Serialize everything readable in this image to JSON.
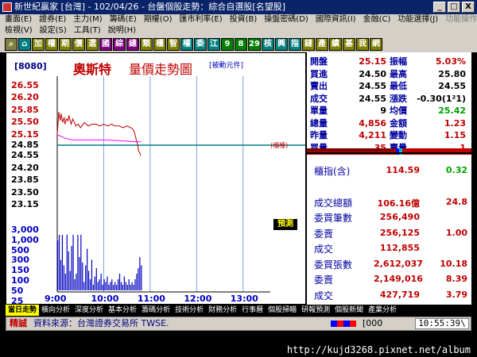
{
  "window": {
    "title": "新世紀贏家 [台灣] - 102/04/26 - 台盤個股走勢：綜合自選股[名望股]",
    "min": "_",
    "max": "□",
    "close": "X"
  },
  "menu": {
    "row1": [
      "畫面(E)",
      "證券(E)",
      "主力(M)",
      "籌碼(E)",
      "期權(O)",
      "匯市利率(E)",
      "投資(B)",
      "操盤密碼(D)",
      "國際資訊(I)",
      "金融(C)",
      "功能選擇(J)"
    ],
    "row1_right": "功能操作(",
    "row2": [
      "檢視(V)",
      "設定(S)",
      "工具(T)",
      "說明(H)"
    ]
  },
  "toolbar": [
    {
      "label": "⌕",
      "name": "search-icon",
      "bg": "#808040"
    },
    {
      "label": "⌂",
      "name": "home-icon",
      "bg": "#008080"
    },
    {
      "label": "加",
      "name": "tb-add",
      "bg": "#808000"
    },
    {
      "label": "權",
      "name": "tb-weight",
      "bg": "#808000"
    },
    {
      "label": "期",
      "name": "tb-futures",
      "bg": "#808000"
    },
    {
      "label": "價",
      "name": "tb-price",
      "bg": "#808000"
    },
    {
      "label": "選",
      "name": "tb-select",
      "bg": "#808000"
    },
    {
      "label": "國",
      "name": "tb-intl",
      "bg": "#800080"
    },
    {
      "label": "綜",
      "name": "tb-composite",
      "bg": "#800080"
    },
    {
      "label": "總",
      "name": "tb-total",
      "bg": "#800080"
    },
    {
      "label": "類",
      "name": "tb-category",
      "bg": "#808000"
    },
    {
      "label": "櫃",
      "name": "tb-otc",
      "bg": "#808000"
    },
    {
      "label": "智",
      "name": "tb-smart",
      "bg": "#808000"
    },
    {
      "label": "權",
      "name": "tb-rights",
      "bg": "#008080"
    },
    {
      "label": "委",
      "name": "tb-order",
      "bg": "#008080"
    },
    {
      "label": "江",
      "name": "tb-jiang",
      "bg": "#008080"
    },
    {
      "label": "9",
      "name": "tb-9",
      "bg": "#008000"
    },
    {
      "label": "8",
      "name": "tb-8",
      "bg": "#008000"
    },
    {
      "label": "29",
      "name": "tb-29",
      "bg": "#008000"
    },
    {
      "label": "核",
      "name": "tb-core",
      "bg": "#008080"
    },
    {
      "label": "興",
      "name": "tb-emerging",
      "bg": "#008080"
    },
    {
      "label": "指",
      "name": "tb-index",
      "bg": "#008080"
    },
    {
      "label": "鏈",
      "name": "tb-chain",
      "bg": "#808000"
    },
    {
      "label": "產",
      "name": "tb-industry",
      "bg": "#808000"
    },
    {
      "label": "績",
      "name": "tb-perf",
      "bg": "#808000"
    },
    {
      "label": "基",
      "name": "tb-fund",
      "bg": "#808000"
    },
    {
      "label": "我",
      "name": "tb-mine",
      "bg": "#808000"
    },
    {
      "label": "網",
      "name": "tb-web",
      "bg": "#808000"
    }
  ],
  "stock": {
    "code": "[8080]",
    "name": "奧斯特",
    "chart_title": "量價走勢圖",
    "passive": "[被動元件]"
  },
  "chart_labels": {
    "ref": "(櫃檯)",
    "forecast": "預測"
  },
  "quote": [
    {
      "l1": "開盤",
      "v1": "25.15",
      "c1": "#c00000",
      "l2": "振幅",
      "v2": "5.03%",
      "c2": "#c00000"
    },
    {
      "l1": "買進",
      "v1": "24.50",
      "c1": "#000000",
      "l2": "最高",
      "v2": "25.80",
      "c2": "#000000"
    },
    {
      "l1": "賣出",
      "v1": "24.55",
      "c1": "#000000",
      "l2": "最低",
      "v2": "24.55",
      "c2": "#000000"
    },
    {
      "l1": "成交",
      "v1": "24.55",
      "c1": "#000000",
      "l2": "漲跌",
      "v2": "-0.30(1²1)",
      "c2": "#000000"
    },
    {
      "l1": "單量",
      "v1": "9",
      "c1": "#000000",
      "l2": "均價",
      "v2": "25.42",
      "c2": "#00a000"
    },
    {
      "l1": "總量",
      "v1": "4,856",
      "c1": "#c00000",
      "l2": "金額",
      "v2": "1.23",
      "c2": "#c00000"
    },
    {
      "l1": "昨量",
      "v1": "4,211",
      "c1": "#c00000",
      "l2": "變動",
      "v2": "1.15",
      "c2": "#c00000"
    },
    {
      "l1": "買量",
      "v1": "35",
      "c1": "#c00000",
      "l2": "賣量",
      "v2": "1",
      "c2": "#c00000"
    }
  ],
  "lower": {
    "index_label": "櫃指(含)",
    "index_val": "114.59",
    "index_chg": "0.32",
    "turnover_label": "成交總額",
    "turnover_val": "106.16億",
    "turnover_chg": "24.8",
    "rows": [
      {
        "label": "委買筆數",
        "v": "256,490",
        "r": ""
      },
      {
        "label": "委賣",
        "v": "256,125",
        "r": "1.00"
      },
      {
        "label": "成交",
        "v": "112,855",
        "r": ""
      },
      {
        "label": "委買張數",
        "v": "2,612,037",
        "r": "10.18"
      },
      {
        "label": "委賣",
        "v": "2,149,016",
        "r": "8.39"
      },
      {
        "label": "成交",
        "v": "427,719",
        "r": "3.79"
      }
    ]
  },
  "tabs": [
    "當日走勢",
    "橫向分析",
    "深度分析",
    "基本分析",
    "籌碼分析",
    "技術分析",
    "財務分析",
    "行事曆",
    "個股掃瞄",
    "研報預測",
    "個股新聞",
    "產業分析"
  ],
  "status": {
    "label": "精誠",
    "source": "資料來源：台灣證券交易所 TWSE.",
    "num": "[000",
    "time": "10:55:39\\"
  },
  "watermark": "http://kujd3268.pixnet.net/album",
  "colors": {
    "price_line": "#c00000",
    "avg_line": "#ff00ff",
    "ref_line": "#008080",
    "volume": "#0000c0",
    "grid": "#80a0e0"
  },
  "chart_data": {
    "type": "line",
    "y_price_ticks": [
      "26.55",
      "26.20",
      "25.85",
      "25.50",
      "25.15",
      "24.85",
      "24.55",
      "24.20",
      "23.85",
      "23.50",
      "23.15"
    ],
    "y_volume_ticks": [
      "3,000",
      "1,000",
      "500",
      "300",
      "150",
      "100",
      "50",
      "25",
      "15",
      "張"
    ],
    "x_ticks": [
      "9:00",
      "10:00",
      "11:00",
      "12:00",
      "13:00"
    ],
    "reference_price": 24.85,
    "price_range": [
      23.15,
      26.55
    ],
    "time_range_min": [
      0,
      270
    ],
    "series": [
      {
        "kind": "price",
        "x": [
          0,
          2,
          4,
          5,
          7,
          9,
          10,
          12,
          14,
          15,
          18,
          20,
          22,
          24,
          27,
          30,
          35,
          40,
          45,
          50,
          55,
          60,
          65,
          70,
          75,
          80,
          85,
          90,
          95,
          98,
          100,
          102,
          104,
          105,
          107,
          108
        ],
        "y": [
          25.15,
          25.8,
          25.55,
          25.75,
          25.5,
          25.65,
          25.45,
          25.6,
          25.55,
          25.7,
          25.45,
          25.6,
          25.5,
          25.4,
          25.45,
          25.35,
          25.5,
          25.4,
          25.45,
          25.45,
          25.4,
          25.45,
          25.4,
          25.45,
          25.4,
          25.4,
          25.35,
          25.4,
          25.35,
          25.3,
          25.2,
          25.0,
          24.85,
          24.7,
          24.6,
          24.55
        ]
      },
      {
        "kind": "average",
        "x": [
          0,
          10,
          20,
          40,
          60,
          80,
          100,
          108
        ],
        "y": [
          25.15,
          25.05,
          25.0,
          25.0,
          25.0,
          24.98,
          24.95,
          24.95
        ]
      }
    ],
    "volume": {
      "x": [
        0,
        2,
        4,
        6,
        8,
        10,
        12,
        14,
        16,
        18,
        20,
        22,
        24,
        26,
        28,
        30,
        32,
        34,
        36,
        38,
        40,
        42,
        44,
        46,
        48,
        50,
        52,
        54,
        56,
        58,
        60,
        62,
        64,
        66,
        68,
        70,
        72,
        74,
        76,
        78,
        80,
        82,
        84,
        86,
        88,
        90,
        92,
        94,
        96,
        98,
        100,
        102,
        104,
        106,
        108
      ],
      "values": [
        180,
        320,
        110,
        250,
        90,
        60,
        220,
        140,
        70,
        160,
        300,
        40,
        60,
        200,
        120,
        260,
        100,
        30,
        90,
        150,
        70,
        40,
        110,
        20,
        50,
        80,
        30,
        40,
        60,
        20,
        40,
        30,
        50,
        20,
        30,
        40,
        20,
        30,
        20,
        40,
        60,
        30,
        20,
        50,
        30,
        20,
        40,
        20,
        30,
        20,
        40,
        60,
        80,
        120,
        90
      ],
      "scale_max": 200
    }
  }
}
